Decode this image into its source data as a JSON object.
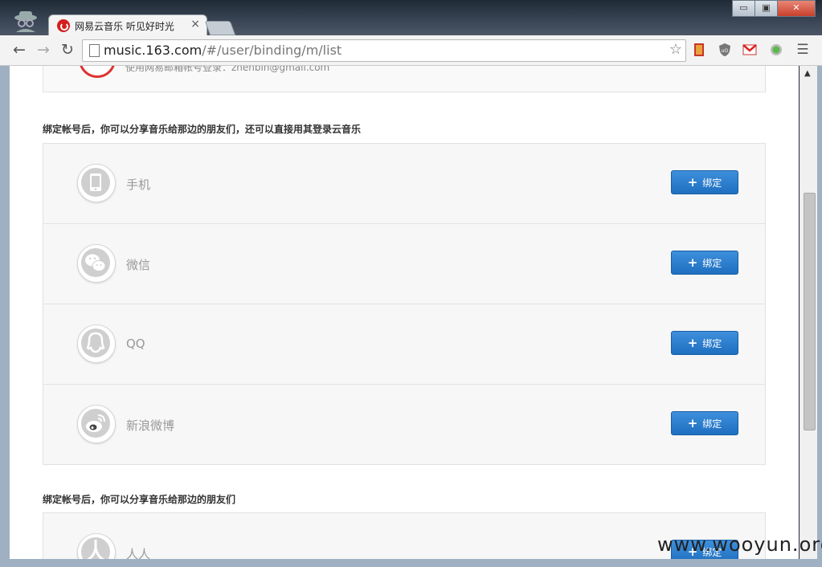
{
  "browser": {
    "tab_title": "网易云音乐 听见好时光",
    "tab_close": "×",
    "url_host": "music.163.com",
    "url_path": "/#/user/binding/m/list",
    "window_controls": {
      "minimize": "▭",
      "maximize": "▣",
      "close": "✕"
    }
  },
  "page": {
    "top_box_text": "使用网易邮箱帐号登录：zhenbin@gmail.com",
    "section1_title": "绑定帐号后，你可以分享音乐给那边的朋友们，还可以直接用其登录云音乐",
    "section2_title": "绑定帐号后，你可以分享音乐给那边的朋友们",
    "accounts": [
      {
        "name": "手机",
        "icon": "phone-icon",
        "button": "绑定"
      },
      {
        "name": "微信",
        "icon": "wechat-icon",
        "button": "绑定"
      },
      {
        "name": "QQ",
        "icon": "qq-icon",
        "button": "绑定"
      },
      {
        "name": "新浪微博",
        "icon": "weibo-icon",
        "button": "绑定"
      }
    ],
    "accounts2": [
      {
        "name": "人人",
        "icon": "renren-icon",
        "button": "绑定"
      }
    ],
    "plus": "+"
  },
  "watermark": "www.wooyun.org",
  "colors": {
    "button_blue": "#2a7dd0",
    "brand_red": "#d61e1e"
  }
}
